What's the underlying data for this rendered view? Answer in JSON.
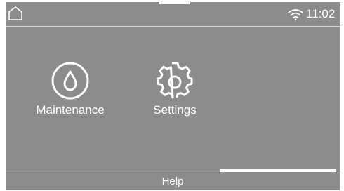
{
  "status_bar": {
    "time": "11:02",
    "home_icon": "home-icon",
    "wifi_icon": "wifi-icon"
  },
  "menu": {
    "items": [
      {
        "label": "Maintenance",
        "icon": "water-drop-icon"
      },
      {
        "label": "Settings",
        "icon": "gear-icon"
      }
    ]
  },
  "footer": {
    "help_label": "Help"
  },
  "colors": {
    "background": "#8c8c8e",
    "foreground": "#ffffff",
    "divider": "#d6d6d8"
  }
}
